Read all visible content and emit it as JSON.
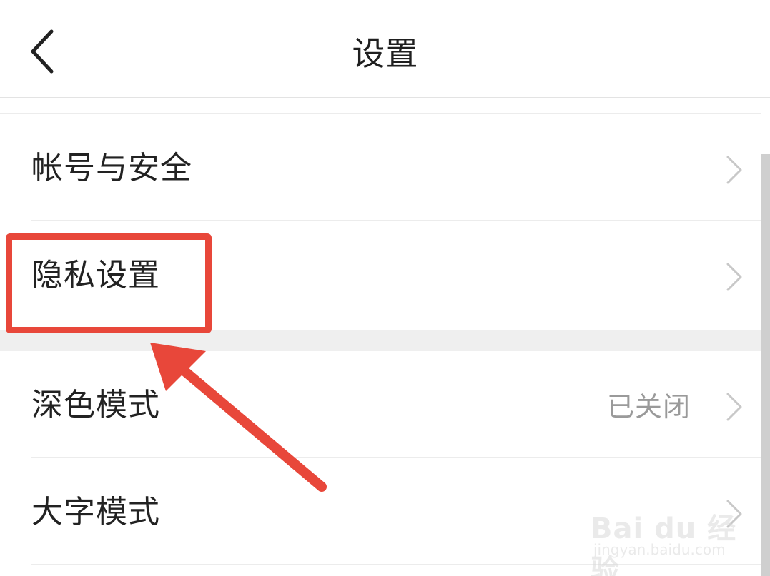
{
  "header": {
    "title": "设置",
    "back_icon": "chevron-left-icon"
  },
  "settings": {
    "items": [
      {
        "label": "帐号与安全",
        "value": "",
        "icon": "chevron-right-icon"
      },
      {
        "label": "隐私设置",
        "value": "",
        "icon": "chevron-right-icon"
      },
      {
        "label": "深色模式",
        "value": "已关闭",
        "icon": "chevron-right-icon"
      },
      {
        "label": "大字模式",
        "value": "",
        "icon": "chevron-right-icon"
      }
    ]
  },
  "annotation": {
    "highlight_color": "#e8473a",
    "highlighted_item": "隐私设置"
  },
  "watermark": {
    "brand": "Bai du 经验",
    "url": "jingyan.baidu.com"
  },
  "colors": {
    "text": "#222222",
    "secondary_text": "#9a9a9a",
    "divider": "#ececec",
    "chevron": "#c8c8c8"
  }
}
